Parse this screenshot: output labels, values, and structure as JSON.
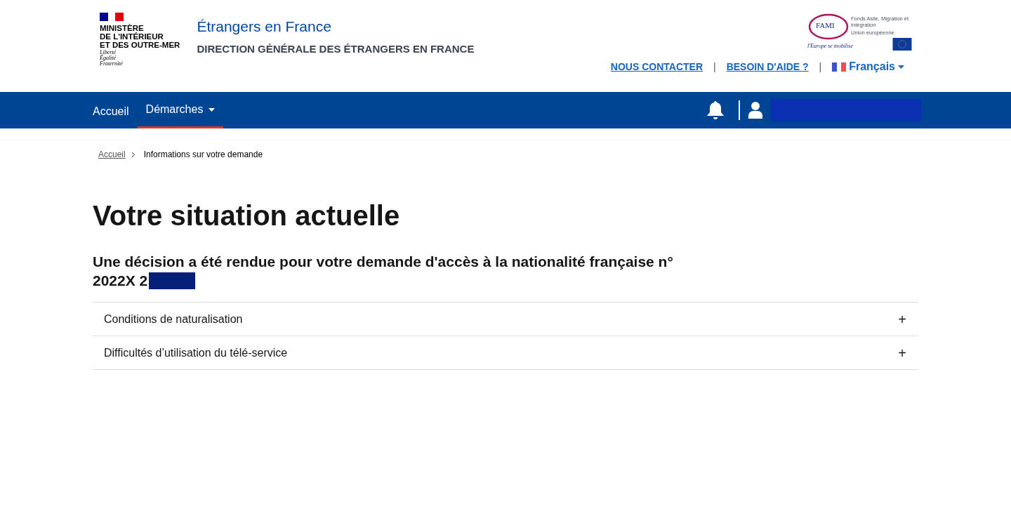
{
  "header": {
    "ministry": [
      "MINISTÈRE",
      "DE L'INTÉRIEUR",
      "ET DES OUTRE-MER"
    ],
    "motto": [
      "Liberté",
      "Égalité",
      "Fraternité"
    ],
    "site_title": "Étrangers en France",
    "site_subtitle": "DIRECTION GÉNÉRALE DES ÉTRANGERS EN FRANCE",
    "partner_logo": {
      "name": "FAMI",
      "caption": "Fonds Asile, Migration et Intégration",
      "union": "Union européenne",
      "slogan": "l'Europe se mobilise"
    },
    "links": [
      "NOUS CONTACTER",
      "BESOIN D'AIDE ?"
    ],
    "separator": "|",
    "language": "Français"
  },
  "nav": {
    "items": [
      {
        "label": "Accueil",
        "selected": false,
        "dropdown": false
      },
      {
        "label": "Démarches",
        "selected": true,
        "dropdown": true
      }
    ]
  },
  "breadcrumb": [
    "Accueil",
    "Informations sur votre demande"
  ],
  "title": "Votre situation actuelle",
  "subtitle": [
    "Une décision a été rendue pour votre demande d'accès à la nationalité française n°",
    "2022X 2"
  ],
  "accordion": [
    {
      "label": "Conditions de naturalisation",
      "expanded": false,
      "toggle": "+"
    },
    {
      "label": "Difficultés d’utilisation du télé-service",
      "expanded": false,
      "toggle": "+"
    }
  ]
}
